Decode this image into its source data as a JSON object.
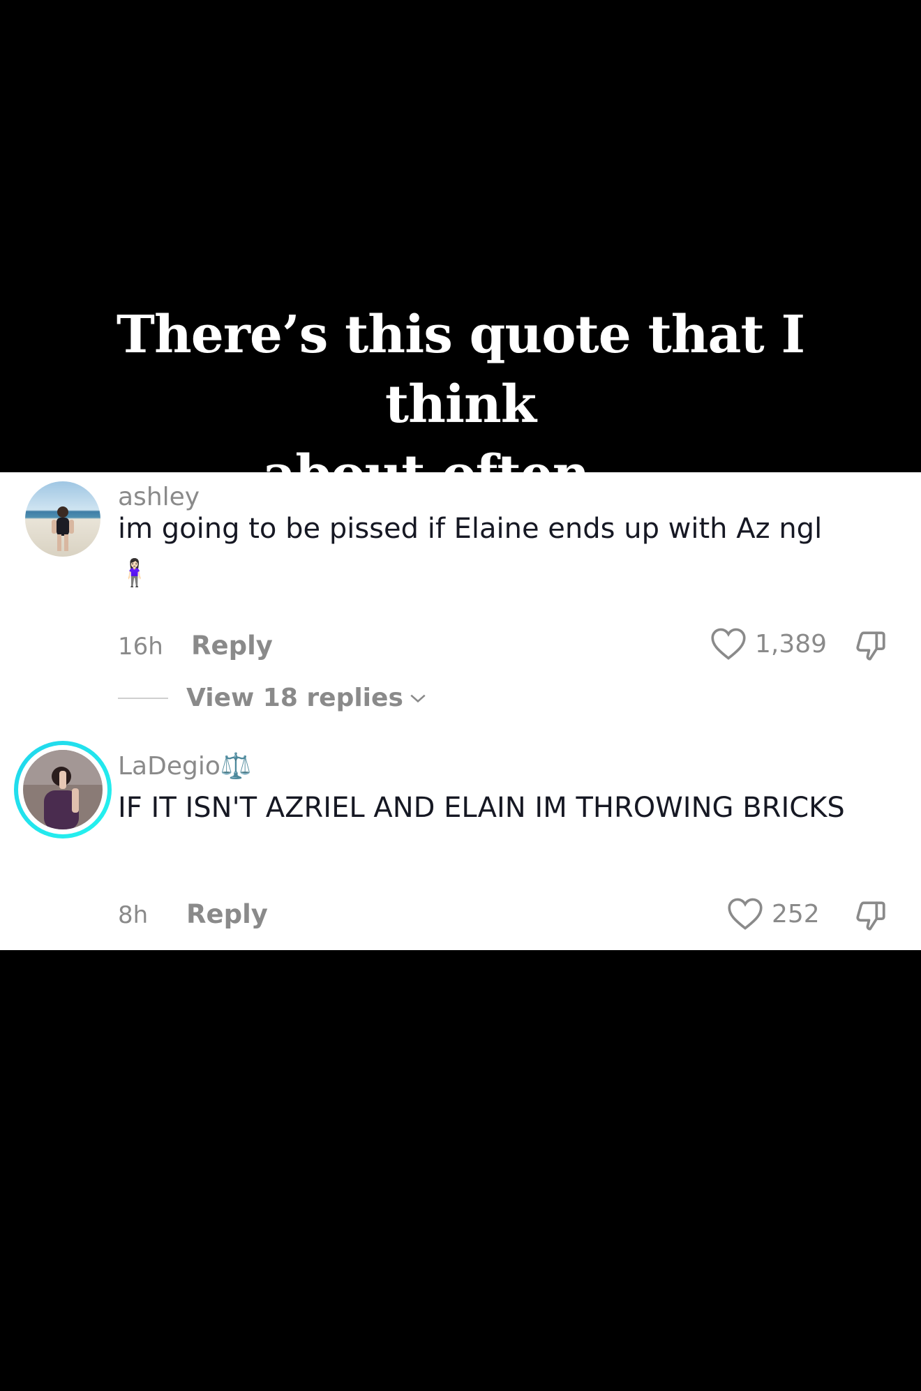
{
  "caption": {
    "line1": "There’s this quote that I think",
    "line2": "about often...."
  },
  "comments": [
    {
      "username": "ashley",
      "text": "im going to be pissed if Elaine ends up with Az ngl",
      "emoji": "🧍🏻‍♀️",
      "time": "16h",
      "reply_label": "Reply",
      "likes": "1,389",
      "view_replies": "View 18 replies",
      "avatar_icon": "avatar-photo-beach"
    },
    {
      "username": "LaDegio⚖️",
      "text": "IF IT ISN'T AZRIEL AND ELAIN IM THROWING BRICKS",
      "time": "8h",
      "reply_label": "Reply",
      "likes": "252",
      "avatar_icon": "avatar-photo-story-ring",
      "ring_colors": [
        "#20d5ec",
        "#25f4ee"
      ]
    }
  ],
  "colors": {
    "panel_bg": "#ffffff",
    "page_bg": "#000000",
    "muted_text": "#8a8a8a",
    "primary_text": "#161823"
  }
}
